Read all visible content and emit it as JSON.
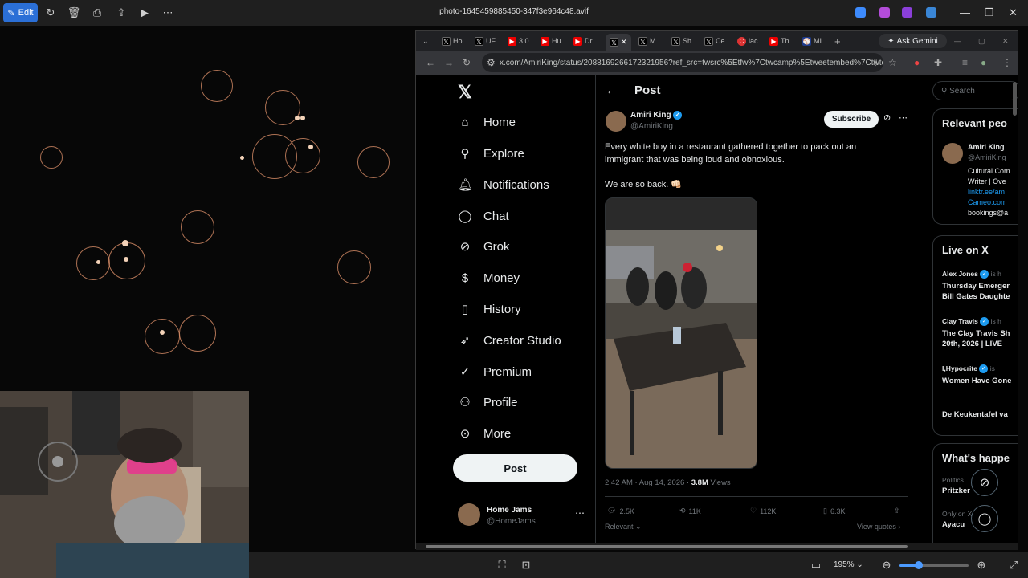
{
  "viewer": {
    "edit_label": "Edit",
    "title": "photo-1645459885450-347f3e964c48.avif",
    "zoom": "195%",
    "colors": {
      "accent": "#2b6fd6",
      "bar": "#1f1f1f"
    }
  },
  "browser": {
    "tabs": [
      {
        "icon": "x-logo-icon",
        "label": "Ho"
      },
      {
        "icon": "x-logo-icon",
        "label": "UF"
      },
      {
        "icon": "youtube-icon",
        "label": "3.0"
      },
      {
        "icon": "youtube-icon",
        "label": "Hu"
      },
      {
        "icon": "youtube-icon",
        "label": "Dr"
      },
      {
        "icon": "x-logo-icon",
        "label": "X",
        "active": true
      },
      {
        "icon": "x-logo-icon",
        "label": "M"
      },
      {
        "icon": "x-logo-icon",
        "label": "Sh"
      },
      {
        "icon": "x-logo-icon",
        "label": "Ce"
      },
      {
        "icon": "red-c-icon",
        "label": "lac"
      },
      {
        "icon": "youtube-icon",
        "label": "Th"
      },
      {
        "icon": "mlb-icon",
        "label": "MI"
      }
    ],
    "ask_gemini": "Ask Gemini",
    "url": "x.com/AmiriKing/status/2088169266172321956?ref_src=twsrc%5Etfw%7Ctwcamp%5Etweetembed%7Ctwter..."
  },
  "x_nav": {
    "items": [
      {
        "icon": "home-icon",
        "label": "Home"
      },
      {
        "icon": "search-icon",
        "label": "Explore"
      },
      {
        "icon": "bell-icon",
        "label": "Notifications"
      },
      {
        "icon": "chat-icon",
        "label": "Chat"
      },
      {
        "icon": "grok-icon",
        "label": "Grok"
      },
      {
        "icon": "money-icon",
        "label": "Money"
      },
      {
        "icon": "bookmark-icon",
        "label": "History"
      },
      {
        "icon": "rocket-icon",
        "label": "Creator Studio"
      },
      {
        "icon": "premium-icon",
        "label": "Premium"
      },
      {
        "icon": "profile-icon",
        "label": "Profile"
      },
      {
        "icon": "more-icon",
        "label": "More"
      }
    ],
    "post_button": "Post",
    "account": {
      "name": "Home Jams",
      "handle": "@HomeJams"
    }
  },
  "post": {
    "header": "Post",
    "author": {
      "name": "Amiri King",
      "handle": "@AmiriKing"
    },
    "subscribe": "Subscribe",
    "text_line1": "Every white boy in a restaurant gathered together to pack out an immigrant that was being loud and obnoxious.",
    "text_line2": "We are so back. 👊🏻",
    "time": "2:42 AM · Aug 14, 2026 · ",
    "views_count": "3.8M",
    "views_label": " Views",
    "stats": {
      "replies": "2.5K",
      "reposts": "11K",
      "likes": "112K",
      "bookmarks": "6.3K"
    },
    "relevant": "Relevant",
    "view_quotes": "View quotes"
  },
  "right": {
    "search_placeholder": "Search",
    "relevant_people_title": "Relevant peo",
    "person": {
      "name": "Amiri King",
      "handle": "@AmiriKing",
      "bio1": "Cultural Com",
      "bio2": "Writer | Ove",
      "link1": "linktr.ee/am",
      "link2": "Cameo.com",
      "email": "bookings@a"
    },
    "live_title": "Live on X",
    "live": [
      {
        "host": "Alex Jones",
        "suffix": "is h",
        "title1": "Thursday Emerger",
        "title2": "Bill Gates Daughte"
      },
      {
        "host": "Clay Travis",
        "suffix": "is h",
        "title1": "The Clay Travis Sh",
        "title2": "20th, 2026 | LIVE"
      },
      {
        "host": "I,Hypocrite",
        "suffix": "is",
        "title1": "Women Have Gone",
        "title2": ""
      }
    ],
    "live_extra": "De Keukentafel va",
    "happening_title": "What's happe",
    "trends": [
      {
        "category": "Politics",
        "name": "Pritzker"
      },
      {
        "category": "Only on X",
        "name": "Ayacu"
      }
    ]
  }
}
